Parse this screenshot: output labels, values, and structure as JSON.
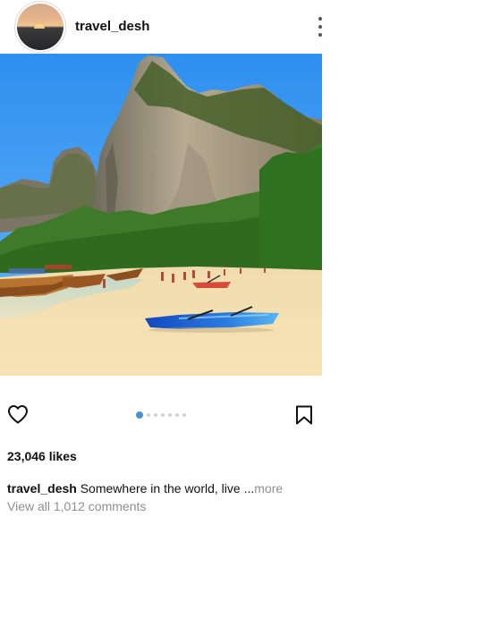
{
  "post": {
    "username": "travel_desh",
    "likes": "23,046 likes",
    "caption": {
      "username": "travel_desh",
      "text": "Somewhere in the world, live ...",
      "more": "more"
    },
    "comments_link": "View all 1,012 comments",
    "carousel": {
      "total": 7,
      "active_index": 0
    },
    "icons": {
      "avatar": "profile-photo-sunset",
      "menu": "more-vertical-icon",
      "like": "heart-icon",
      "save": "bookmark-icon"
    },
    "colors": {
      "accent": "#4a90d9",
      "muted": "#8e8e8e"
    }
  }
}
